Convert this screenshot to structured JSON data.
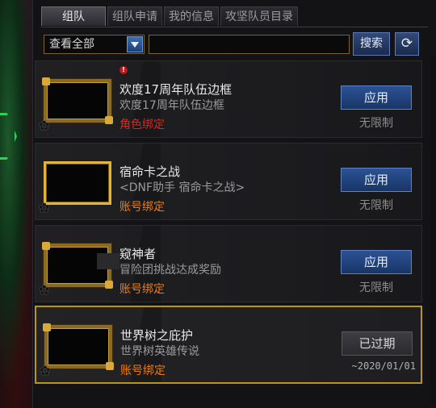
{
  "tabs": [
    {
      "label": "组队"
    },
    {
      "label": "组队申请"
    },
    {
      "label": "我的信息"
    },
    {
      "label": "攻坚队员目录"
    }
  ],
  "filter": {
    "selected": "查看全部",
    "search_value": "",
    "search_label": "搜索",
    "refresh_icon": "refresh-icon"
  },
  "items": [
    {
      "alert": "!",
      "name": "欢度17周年队伍边框",
      "desc": "欢度17周年队伍边框",
      "bind": "角色绑定",
      "bind_color": "#e0241e",
      "action": "应用",
      "status": "无限制",
      "frame": "gold-ornate"
    },
    {
      "name": "宿命卡之战",
      "desc": "<DNF助手 宿命卡之战>",
      "bind": "账号绑定",
      "bind_color": "#f07a12",
      "action": "应用",
      "status": "无限制",
      "frame": "gold-plain"
    },
    {
      "name": "窥神者",
      "desc": "冒险团挑战达成奖励",
      "bind": "账号绑定",
      "bind_color": "#f07a12",
      "action": "应用",
      "status": "无限制",
      "frame": "gold-ornate"
    },
    {
      "name": "世界树之庇护",
      "desc": "世界树英雄传说",
      "bind": "账号绑定",
      "bind_color": "#f07a12",
      "action": "已过期",
      "status": "~2020/01/01",
      "frame": "gold-ornate",
      "selected": true
    }
  ]
}
